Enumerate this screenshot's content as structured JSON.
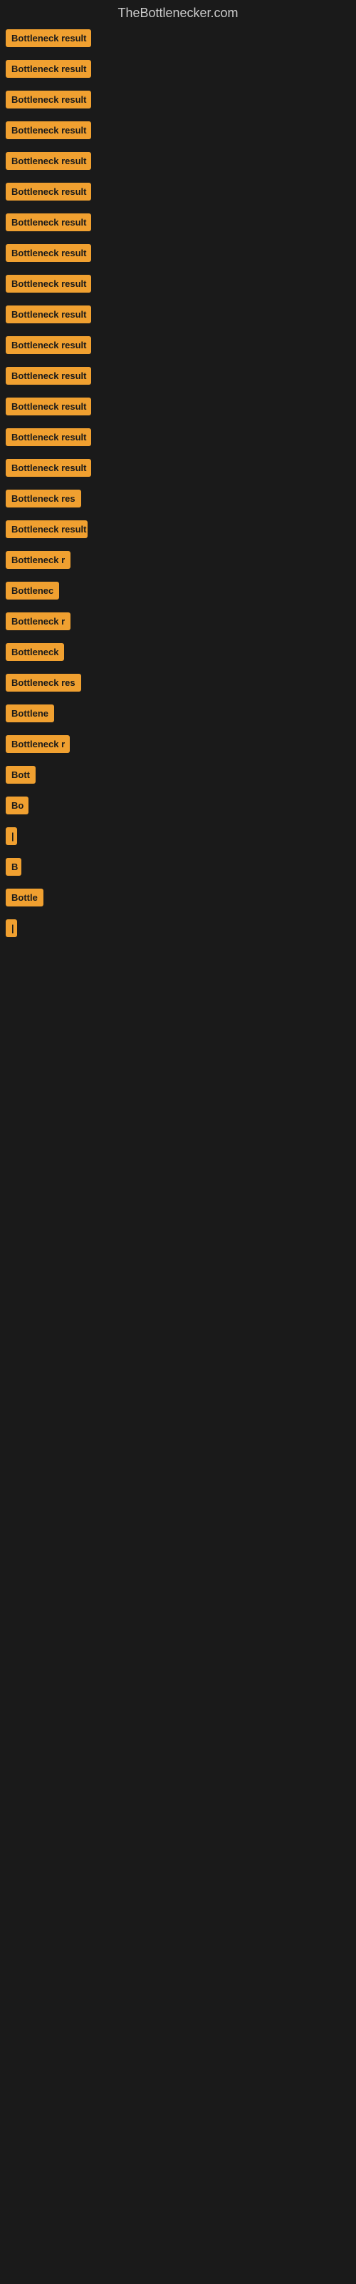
{
  "site": {
    "title": "TheBottlenecker.com"
  },
  "items": [
    {
      "label": "Bottleneck result",
      "width": 120
    },
    {
      "label": "Bottleneck result",
      "width": 120
    },
    {
      "label": "Bottleneck result",
      "width": 120
    },
    {
      "label": "Bottleneck result",
      "width": 120
    },
    {
      "label": "Bottleneck result",
      "width": 120
    },
    {
      "label": "Bottleneck result",
      "width": 120
    },
    {
      "label": "Bottleneck result",
      "width": 120
    },
    {
      "label": "Bottleneck result",
      "width": 120
    },
    {
      "label": "Bottleneck result",
      "width": 120
    },
    {
      "label": "Bottleneck result",
      "width": 120
    },
    {
      "label": "Bottleneck result",
      "width": 120
    },
    {
      "label": "Bottleneck result",
      "width": 120
    },
    {
      "label": "Bottleneck result",
      "width": 120
    },
    {
      "label": "Bottleneck result",
      "width": 120
    },
    {
      "label": "Bottleneck result",
      "width": 120
    },
    {
      "label": "Bottleneck res",
      "width": 108
    },
    {
      "label": "Bottleneck result",
      "width": 115
    },
    {
      "label": "Bottleneck r",
      "width": 95
    },
    {
      "label": "Bottlenec",
      "width": 82
    },
    {
      "label": "Bottleneck r",
      "width": 95
    },
    {
      "label": "Bottleneck",
      "width": 84
    },
    {
      "label": "Bottleneck res",
      "width": 108
    },
    {
      "label": "Bottlene",
      "width": 74
    },
    {
      "label": "Bottleneck r",
      "width": 90
    },
    {
      "label": "Bott",
      "width": 48
    },
    {
      "label": "Bo",
      "width": 32
    },
    {
      "label": "|",
      "width": 14
    },
    {
      "label": "B",
      "width": 22
    },
    {
      "label": "Bottle",
      "width": 54
    },
    {
      "label": "|",
      "width": 14
    }
  ]
}
